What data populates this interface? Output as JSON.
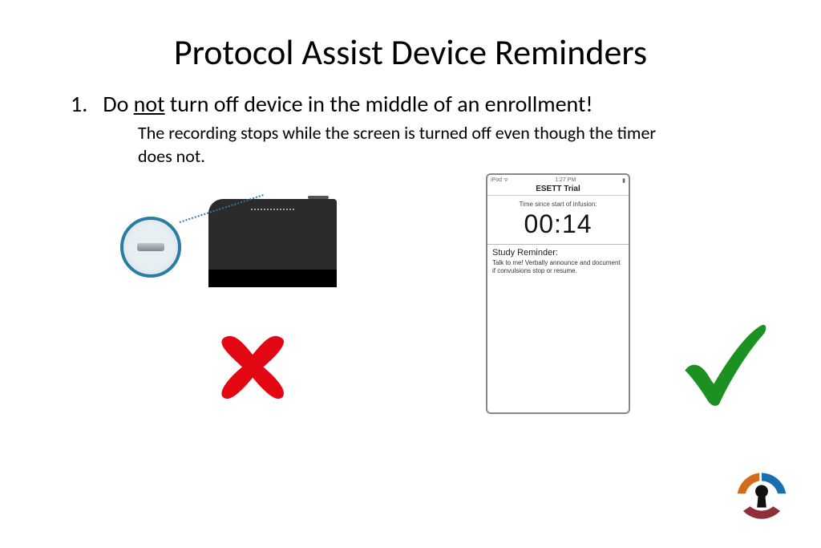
{
  "title": "Protocol Assist Device Reminders",
  "bullet": {
    "number": "1.",
    "pre": "Do ",
    "emph": "not",
    "post": " turn off device in the middle of an enrollment!"
  },
  "subtext": "The recording stops while the screen is turned off even though the timer does not.",
  "phone": {
    "status_left": "iPod ᯤ",
    "status_center": "1:27 PM",
    "status_right": "▮",
    "app_title": "ESETT Trial",
    "timer_label": "Time since start of infusion:",
    "timer_value": "00:14",
    "reminder_heading": "Study Reminder:",
    "reminder_body": "Talk to me!  Verbally announce and document if convulsions stop or resume."
  },
  "marks": {
    "cross_color": "#e30613",
    "check_color": "#1a9120"
  },
  "logo_colors": {
    "top_right": "#1a6fb0",
    "left": "#d46a1a",
    "bottom": "#8f2f3a",
    "center": "#111111"
  }
}
